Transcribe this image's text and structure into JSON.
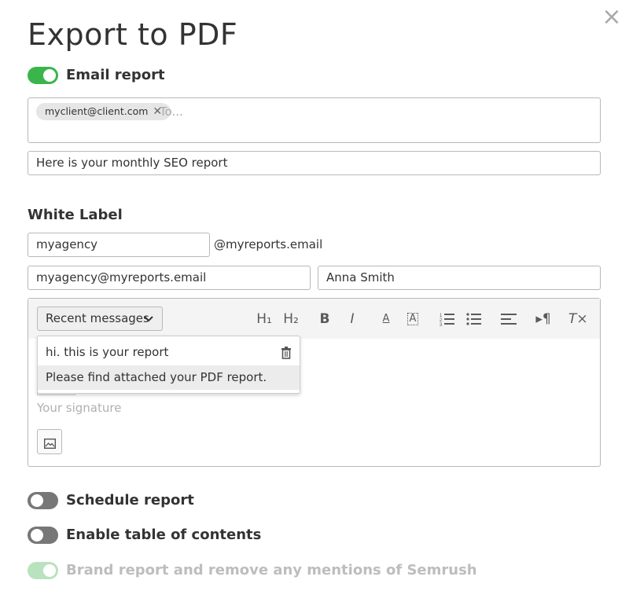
{
  "dialog": {
    "title": "Export to PDF",
    "close_icon": "close-icon",
    "close_glyph": "×"
  },
  "email_report": {
    "label": "Email report",
    "enabled": true,
    "recipients": [
      "myclient@client.com"
    ],
    "to_placeholder": "To...",
    "subject": "Here is your monthly SEO report"
  },
  "white_label": {
    "heading": "White Label",
    "sender_name": "myagency",
    "domain_suffix": "@myreports.email",
    "from_email": "myagency@myreports.email",
    "from_name": "Anna Smith"
  },
  "editor": {
    "recent_messages_label": "Recent messages",
    "toolbar_icons": [
      "heading-1-icon",
      "heading-2-icon",
      "bold-icon",
      "italic-icon",
      "text-color-icon",
      "highlight-icon",
      "ordered-list-icon",
      "bullet-list-icon",
      "align-icon",
      "paragraph-direction-icon",
      "clear-format-icon"
    ],
    "toolbar_glyphs": {
      "h1": "H₁",
      "h2": "H₂",
      "bold": "B",
      "italic": "I",
      "text_color": "A",
      "highlight": "A",
      "ordered_list": "☰",
      "bullet_list": "☰",
      "align": "☰",
      "paragraph": "▸¶",
      "clear": "T×"
    },
    "recent_messages": [
      {
        "text": "hi. this is your report",
        "highlighted": false
      },
      {
        "text": "Please find attached your PDF report.",
        "highlighted": true
      }
    ],
    "signature_placeholder": "Your signature",
    "image_icon": "image-icon"
  },
  "options": [
    {
      "label": "Schedule report",
      "enabled": false,
      "disabled": false
    },
    {
      "label": "Enable table of contents",
      "enabled": false,
      "disabled": false
    },
    {
      "label": "Brand report and remove any mentions of Semrush",
      "enabled": true,
      "disabled": true
    }
  ],
  "colors": {
    "accent_green": "#3ab54a",
    "toggle_off": "#777777",
    "border": "#b8b8b8"
  }
}
